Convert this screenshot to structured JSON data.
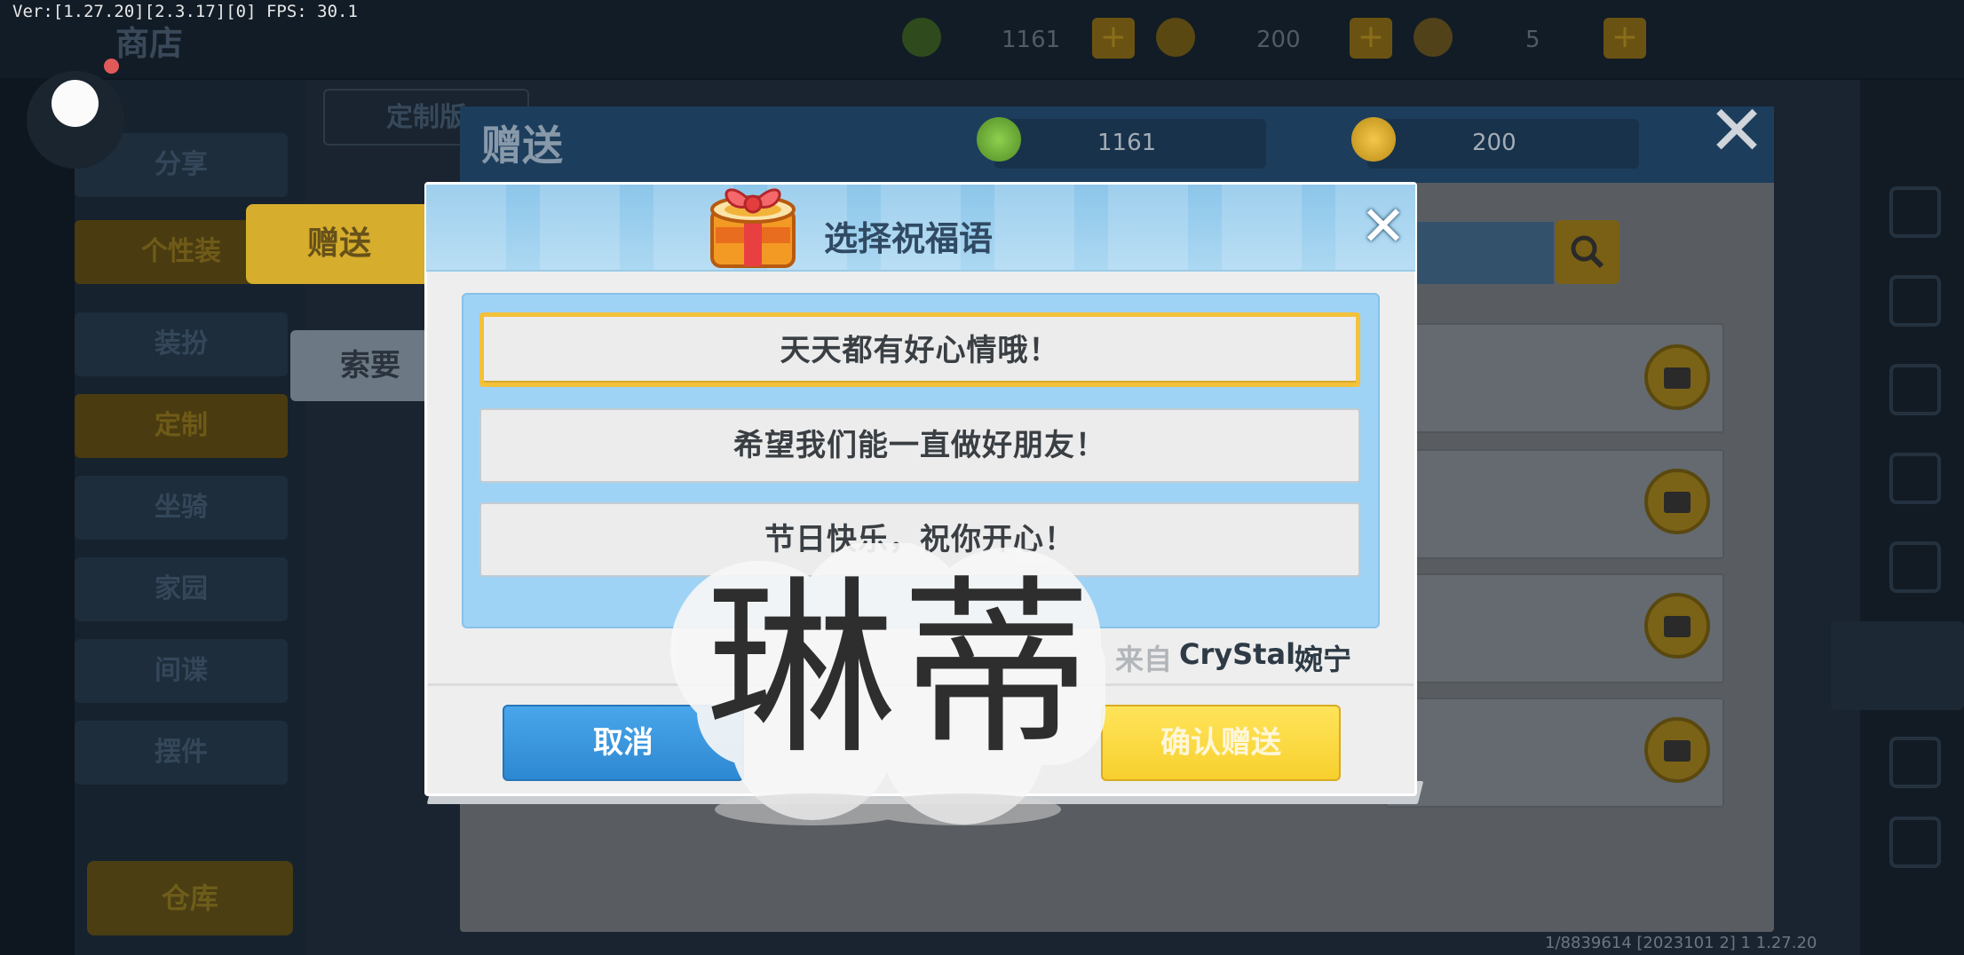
{
  "status": {
    "version_fps": "Ver:[1.27.20][2.3.17][0] FPS: 30.1"
  },
  "background": {
    "shop_title": "商店",
    "currencies": [
      {
        "icon": "mini-coin-icon",
        "value": "1161"
      },
      {
        "icon": "mini-bean-icon",
        "value": "200"
      },
      {
        "icon": "star-icon",
        "value": "5"
      }
    ],
    "left_menu": [
      "分享",
      "个性装",
      "装扮",
      "定制",
      "坐骑",
      "家园",
      "间谍",
      "摆件"
    ],
    "warehouse": "仓库",
    "custom_tab": "定制版",
    "tabs": {
      "gift": "赠送",
      "request": "索要"
    },
    "bottom_info": "1/8839614 [2023101 2] 1 1.27.20"
  },
  "gift_panel": {
    "title": "赠送",
    "currencies": [
      {
        "icon": "mini-coin-icon",
        "value": "1161"
      },
      {
        "icon": "mini-bean-icon",
        "value": "200"
      }
    ]
  },
  "dialog": {
    "title": "选择祝福语",
    "options": [
      "天天都有好心情哦！",
      "希望我们能一直做好朋友！",
      "节日快乐，祝你开心！"
    ],
    "selected_index": 0,
    "from_label": "来自",
    "from_name": "CryStal",
    "from_nick": "婉宁",
    "cancel_label": "取消",
    "confirm_label": "确认赠送"
  },
  "watermark": "琳蒂",
  "colors": {
    "accent_yellow": "#f7d02e",
    "accent_blue": "#2d88d2",
    "selected_border": "#f3c13a"
  }
}
